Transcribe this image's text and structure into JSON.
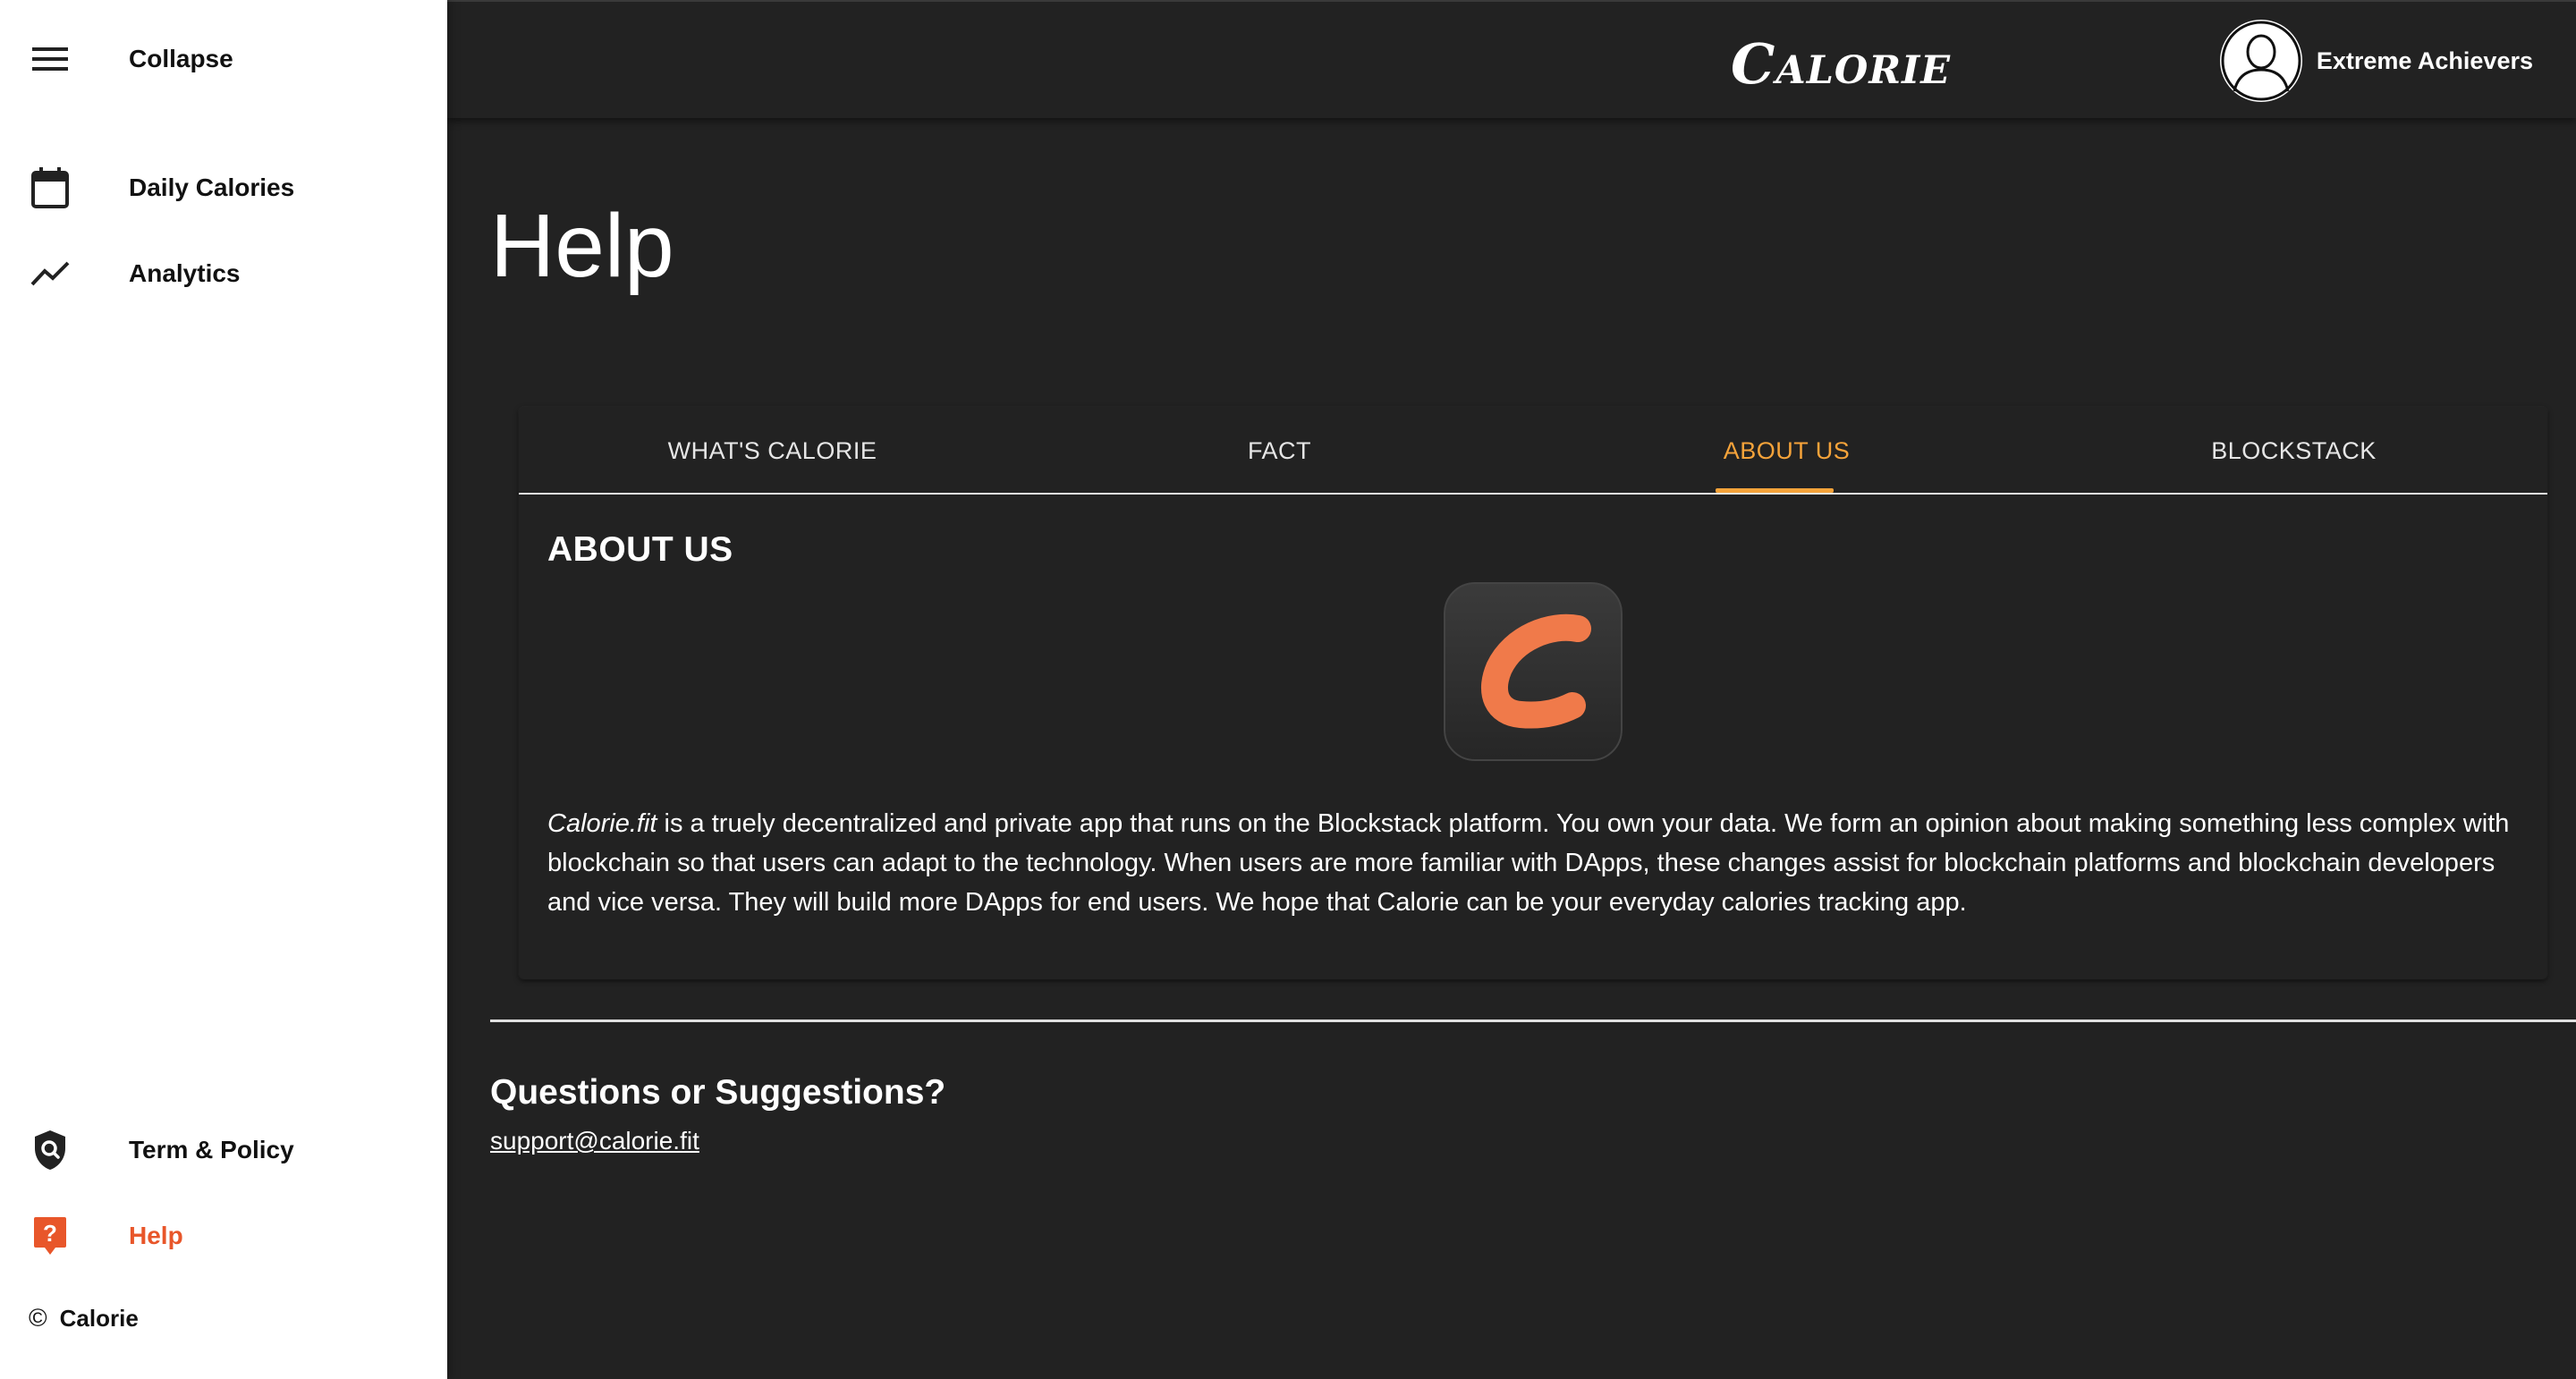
{
  "app": {
    "brand": "Calorie"
  },
  "sidebar": {
    "collapse_label": "Collapse",
    "items": [
      {
        "label": "Daily Calories",
        "icon": "calendar-icon"
      },
      {
        "label": "Analytics",
        "icon": "trending-up-icon"
      }
    ],
    "bottom_items": [
      {
        "label": "Term & Policy",
        "icon": "shield-search-icon"
      },
      {
        "label": "Help",
        "icon": "help-icon",
        "active": true
      }
    ],
    "footer": {
      "symbol": "©",
      "label": "Calorie"
    }
  },
  "header": {
    "user_name": "Extreme Achievers"
  },
  "page": {
    "title": "Help",
    "tabs": [
      {
        "label": "WHAT'S CALORIE"
      },
      {
        "label": "FACT"
      },
      {
        "label": "ABOUT US",
        "active": true
      },
      {
        "label": "BLOCKSTACK"
      }
    ],
    "section_title": "ABOUT US",
    "about_brand": "Calorie.fit",
    "about_text": " is a truely decentralized and private app that runs on the Blockstack platform. You own your data. We form an opinion about making something less complex with blockchain so that users can adapt to the technology. When users are more familiar with DApps, these changes assist for blockchain platforms and blockchain developers and vice versa. They will build more DApps for end users. We hope that Calorie can be your everyday calories tracking app.",
    "questions_title": "Questions or Suggestions?",
    "support_email": "support@calorie.fit"
  },
  "colors": {
    "accent": "#f5a33a",
    "help_active": "#e8562a",
    "logo_mark": "#f07a4a",
    "background": "#222222"
  }
}
